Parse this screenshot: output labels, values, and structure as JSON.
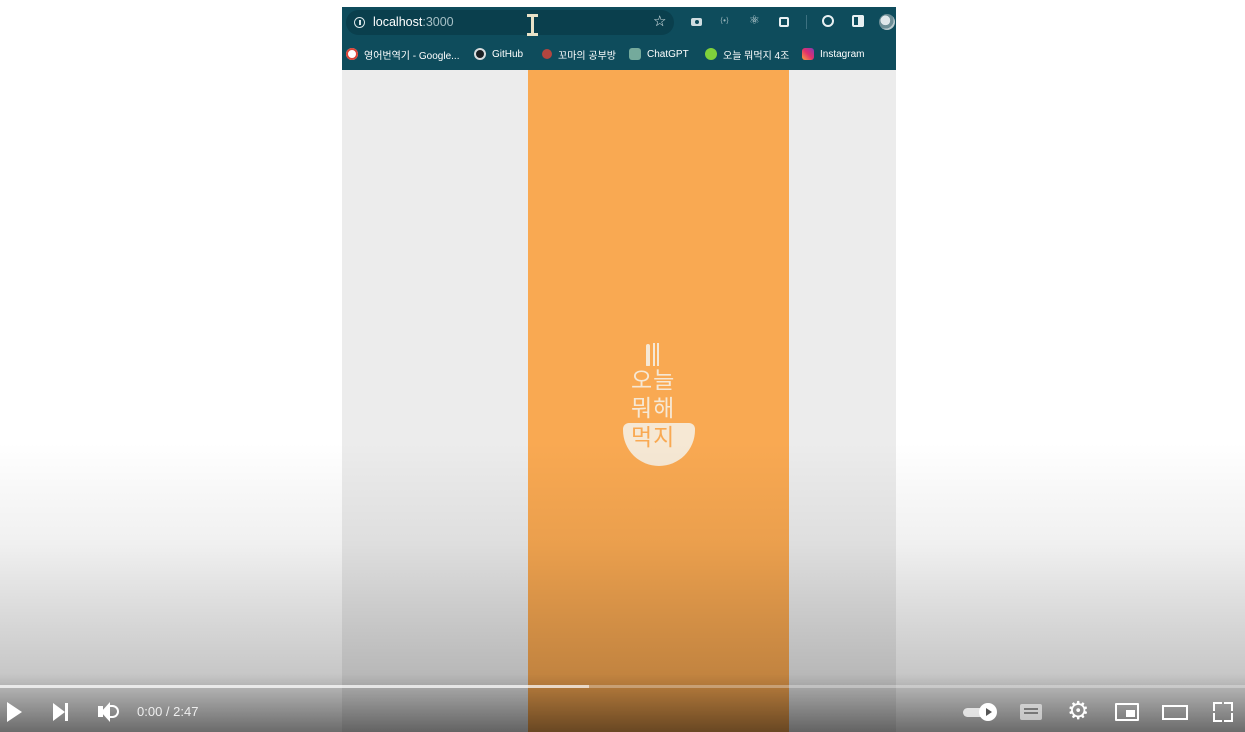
{
  "recorded_browser": {
    "address_bar": {
      "host": "localhost",
      "port": ":3000"
    },
    "bookmarks": [
      {
        "label": "영어번역기 - Google...",
        "icon": "google-icon"
      },
      {
        "label": "GitHub",
        "icon": "github-icon"
      },
      {
        "label": "꼬마의 공부방",
        "icon": "blog-icon"
      },
      {
        "label": "ChatGPT",
        "icon": "chatgpt-icon"
      },
      {
        "label": "오늘 뭐먹지 4조",
        "icon": "app-icon"
      },
      {
        "label": "Instagram",
        "icon": "instagram-icon"
      }
    ]
  },
  "app_splash": {
    "background_color": "#f9a952",
    "logo_lines": [
      "오늘",
      "뭐해",
      "먹지"
    ]
  },
  "player": {
    "time": "0:00 / 2:47",
    "loaded_fraction": 0.473
  }
}
